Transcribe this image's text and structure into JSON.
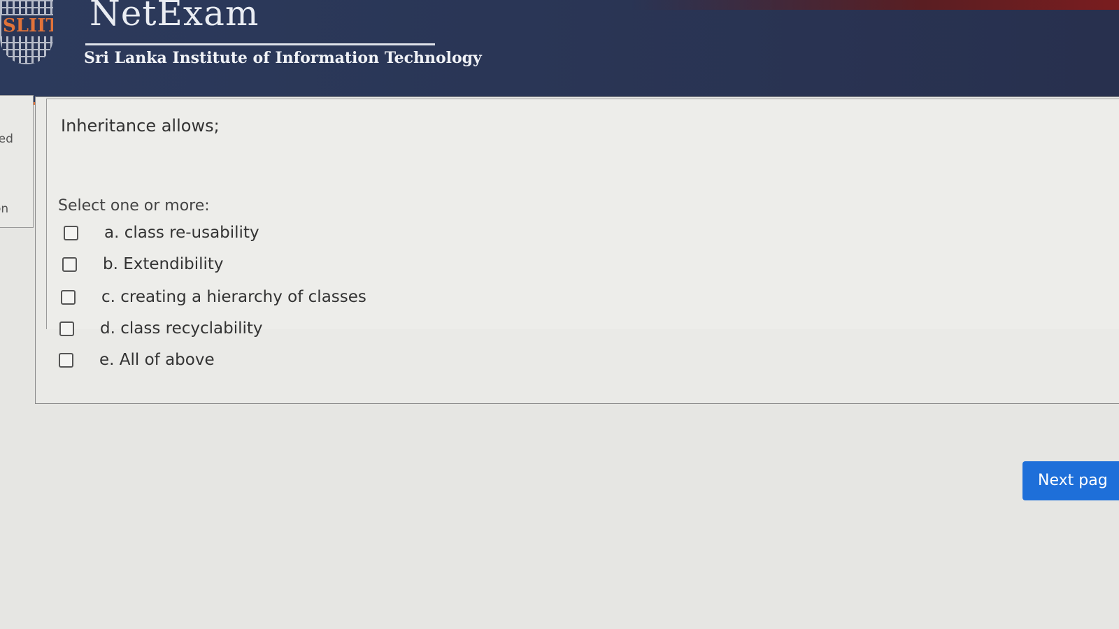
{
  "header": {
    "logo_text": "SLIIT",
    "app_name": "NetExam",
    "institute": "Sri Lanka Institute of Information Technology"
  },
  "sidebar": {
    "label_top": "red",
    "label_bottom": "on"
  },
  "question": {
    "text": "Inheritance allows;",
    "prompt": "Select one or more:",
    "options": [
      {
        "label": "a. class re-usability",
        "checked": false
      },
      {
        "label": "b. Extendibility",
        "checked": false
      },
      {
        "label": "c. creating a hierarchy of classes",
        "checked": false
      },
      {
        "label": "d. class recyclability",
        "checked": false
      },
      {
        "label": "e. All of above",
        "checked": false
      }
    ]
  },
  "navigation": {
    "next_label": "Next pag"
  },
  "colors": {
    "header_bg": "#2c3a5c",
    "header_accent": "#e0733a",
    "button_bg": "#1e6fd9"
  }
}
